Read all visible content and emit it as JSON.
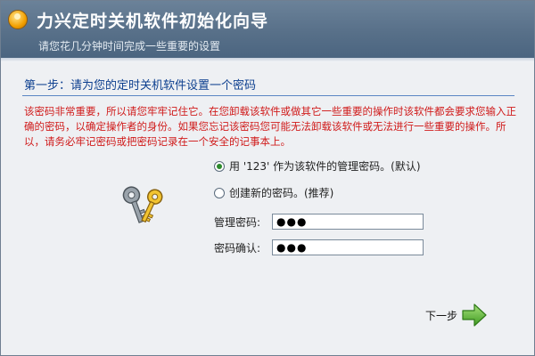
{
  "window": {
    "title": "力兴定时关机软件初始化向导",
    "subtitle": "请您花几分钟时间完成一些重要的设置"
  },
  "step": {
    "title": "第一步：请为您的定时关机软件设置一个密码"
  },
  "warning": {
    "text": "该密码非常重要，所以请您牢牢记住它。在您卸载该软件或做其它一些重要的操作时该软件都会要求您输入正确的密码，以确定操作者的身份。如果您忘记该密码您可能无法卸载该软件或无法进行一些重要的操作。所以，请务必牢记密码或把密码记录在一个安全的记事本上。"
  },
  "options": [
    {
      "label": "用 '123' 作为该软件的管理密码。(默认)",
      "selected": true
    },
    {
      "label": "创建新的密码。(推荐)",
      "selected": false
    }
  ],
  "fields": {
    "admin_password": {
      "label": "管理密码:",
      "value": "●●●"
    },
    "confirm_password": {
      "label": "密码确认:",
      "value": "●●●"
    }
  },
  "buttons": {
    "next_label": "下一步"
  },
  "icons": {
    "app": "app-logo-icon",
    "keys": "keys-icon",
    "next": "green-arrow-right-icon"
  },
  "colors": {
    "header": "#587089",
    "step_text": "#0d3f8f",
    "warning_text": "#d01b1b",
    "arrow": "#4caf2a"
  }
}
